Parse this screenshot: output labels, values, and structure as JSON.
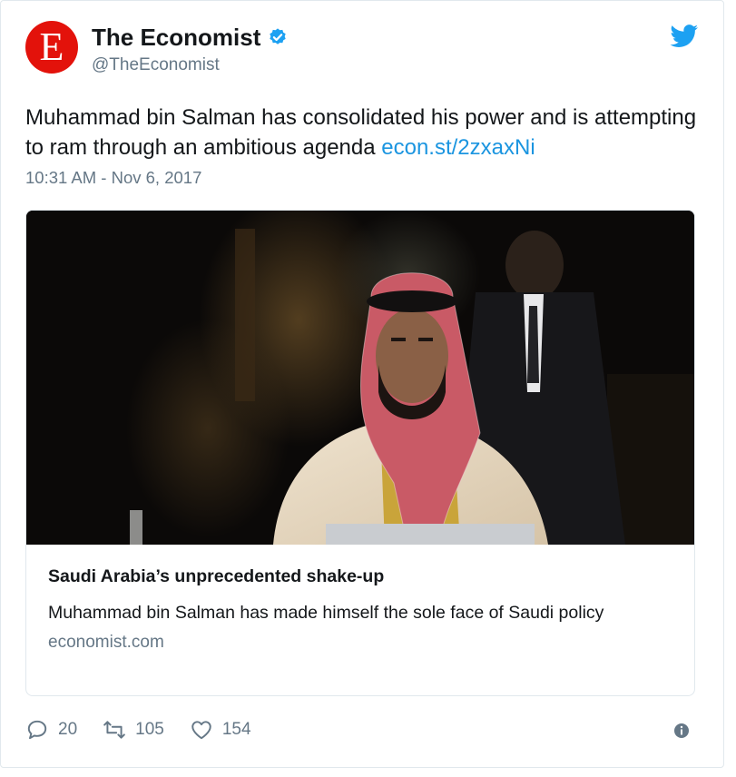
{
  "tweet": {
    "avatar_letter": "E",
    "display_name": "The Economist",
    "handle": "@TheEconomist",
    "text": "Muhammad bin Salman has consolidated his power and is attempting to ram through an ambitious agenda ",
    "link_text": "econ.st/2zxaxNi",
    "timestamp": "10:31 AM - Nov 6, 2017"
  },
  "card": {
    "title": "Saudi Arabia’s unprecedented shake-up",
    "description": "Muhammad bin Salman has made himself the sole face of Saudi policy",
    "domain": "economist.com"
  },
  "actions": {
    "replies": "20",
    "retweets": "105",
    "likes": "154"
  },
  "icons": {
    "verified": "verified-badge-icon",
    "bird": "twitter-bird-icon",
    "reply": "reply-icon",
    "retweet": "retweet-icon",
    "like": "heart-icon",
    "info": "info-icon"
  },
  "colors": {
    "brand_red": "#e3120b",
    "twitter_blue": "#1da1f2",
    "link_blue": "#1b95e0",
    "muted_gray": "#657786"
  }
}
